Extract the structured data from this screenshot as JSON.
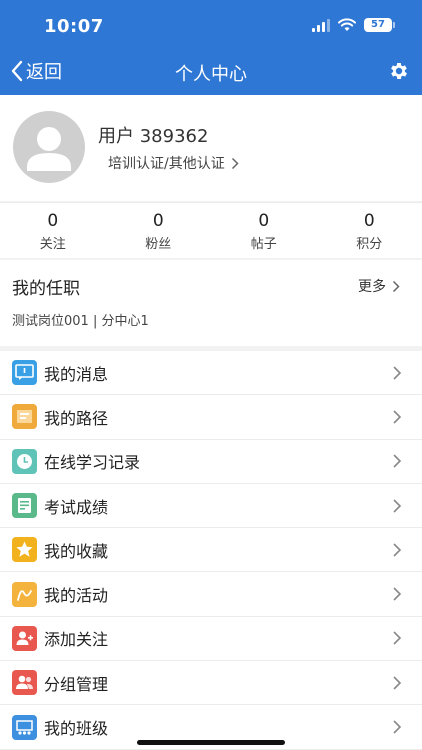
{
  "status_bar": {
    "time": "10:07",
    "battery": "57"
  },
  "nav": {
    "back_label": "返回",
    "title": "个人中心"
  },
  "profile": {
    "username": "用户 389362",
    "cert_link": "培训认证/其他认证"
  },
  "stats": [
    {
      "value": "0",
      "label": "关注"
    },
    {
      "value": "0",
      "label": "粉丝"
    },
    {
      "value": "0",
      "label": "帖子"
    },
    {
      "value": "0",
      "label": "积分"
    }
  ],
  "posts": {
    "title": "我的任职",
    "more": "更多",
    "detail": "测试岗位001 | 分中心1"
  },
  "menu": [
    {
      "label": "我的消息",
      "icon": "message-icon",
      "color": "#3aa0e6"
    },
    {
      "label": "我的路径",
      "icon": "path-icon",
      "color": "#f0a93b"
    },
    {
      "label": "在线学习记录",
      "icon": "clock-icon",
      "color": "#5fc3b8"
    },
    {
      "label": "考试成绩",
      "icon": "exam-score-icon",
      "color": "#59b98a"
    },
    {
      "label": "我的收藏",
      "icon": "star-icon",
      "color": "#f2b21e"
    },
    {
      "label": "我的活动",
      "icon": "activity-icon",
      "color": "#f3b33c"
    },
    {
      "label": "添加关注",
      "icon": "add-follow-icon",
      "color": "#e8584f"
    },
    {
      "label": "分组管理",
      "icon": "group-icon",
      "color": "#e8584f"
    },
    {
      "label": "我的班级",
      "icon": "class-icon",
      "color": "#3d8fe0"
    }
  ]
}
